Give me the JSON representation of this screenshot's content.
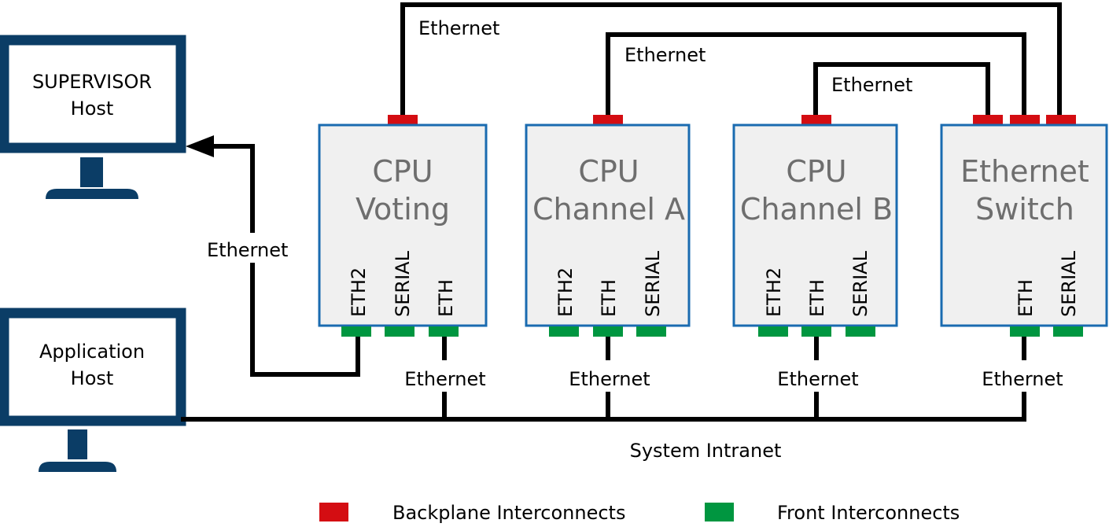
{
  "colors": {
    "monitor": "#0b3d66",
    "module_border": "#1a6bb0",
    "module_fill": "#f0f0f0",
    "module_title": "#6e6e6e",
    "backplane": "#d40d12",
    "front": "#009640",
    "wire": "#000000"
  },
  "hosts": {
    "supervisor": {
      "line1": "SUPERVISOR",
      "line2": "Host"
    },
    "application": {
      "line1": "Application",
      "line2": "Host"
    }
  },
  "modules": {
    "voting": {
      "line1": "CPU",
      "line2": "Voting",
      "ports": [
        "ETH2",
        "SERIAL",
        "ETH"
      ]
    },
    "channel_a": {
      "line1": "CPU",
      "line2": "Channel A",
      "ports": [
        "ETH2",
        "ETH",
        "SERIAL"
      ]
    },
    "channel_b": {
      "line1": "CPU",
      "line2": "Channel B",
      "ports": [
        "ETH2",
        "ETH",
        "SERIAL"
      ]
    },
    "switch": {
      "line1": "Ethernet",
      "line2": "Switch",
      "ports": [
        "ETH",
        "SERIAL"
      ]
    }
  },
  "links": {
    "top_outer": "Ethernet",
    "top_middle": "Ethernet",
    "top_inner": "Ethernet",
    "supervisor_link": "Ethernet",
    "voting_bus": "Ethernet",
    "channel_a_bus": "Ethernet",
    "channel_b_bus": "Ethernet",
    "switch_bus": "Ethernet",
    "bus_name": "System Intranet"
  },
  "legend": {
    "backplane": "Backplane Interconnects",
    "front": "Front Interconnects"
  }
}
